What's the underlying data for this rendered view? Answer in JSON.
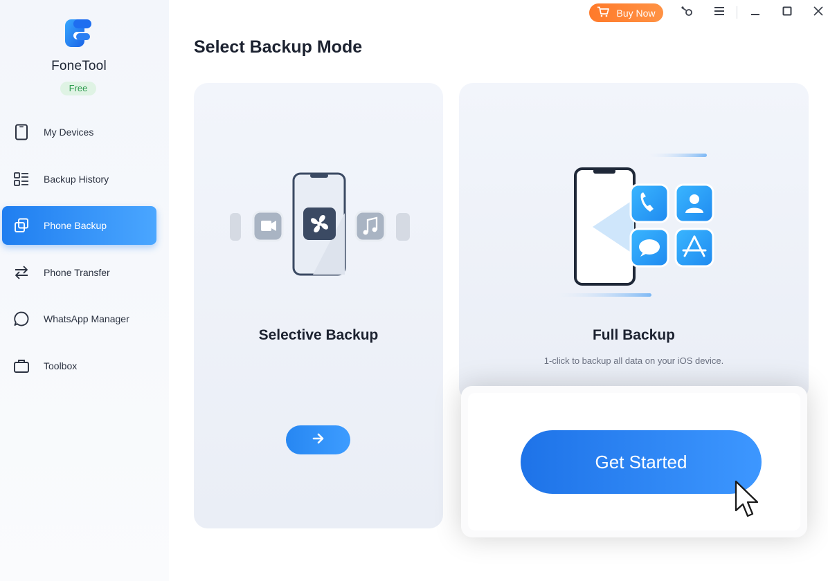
{
  "app": {
    "name": "FoneTool",
    "plan_badge": "Free"
  },
  "titlebar": {
    "buy_now": "Buy Now"
  },
  "sidebar": {
    "items": [
      {
        "label": "My Devices",
        "icon": "phone-icon",
        "active": false
      },
      {
        "label": "Backup History",
        "icon": "list-icon",
        "active": false
      },
      {
        "label": "Phone Backup",
        "icon": "copy-icon",
        "active": true
      },
      {
        "label": "Phone Transfer",
        "icon": "transfer-arrows-icon",
        "active": false
      },
      {
        "label": "WhatsApp Manager",
        "icon": "chat-bubble-icon",
        "active": false
      },
      {
        "label": "Toolbox",
        "icon": "briefcase-icon",
        "active": false
      }
    ]
  },
  "main": {
    "title": "Select Backup Mode",
    "cards": [
      {
        "title": "Selective Backup",
        "subtitle": ""
      },
      {
        "title": "Full Backup",
        "subtitle": "1-click to backup all data on your iOS device."
      }
    ],
    "get_started": "Get Started"
  },
  "colors": {
    "accent": "#2a86f5",
    "buy_now": "#ff8236",
    "free_badge": "#dff3e4"
  }
}
